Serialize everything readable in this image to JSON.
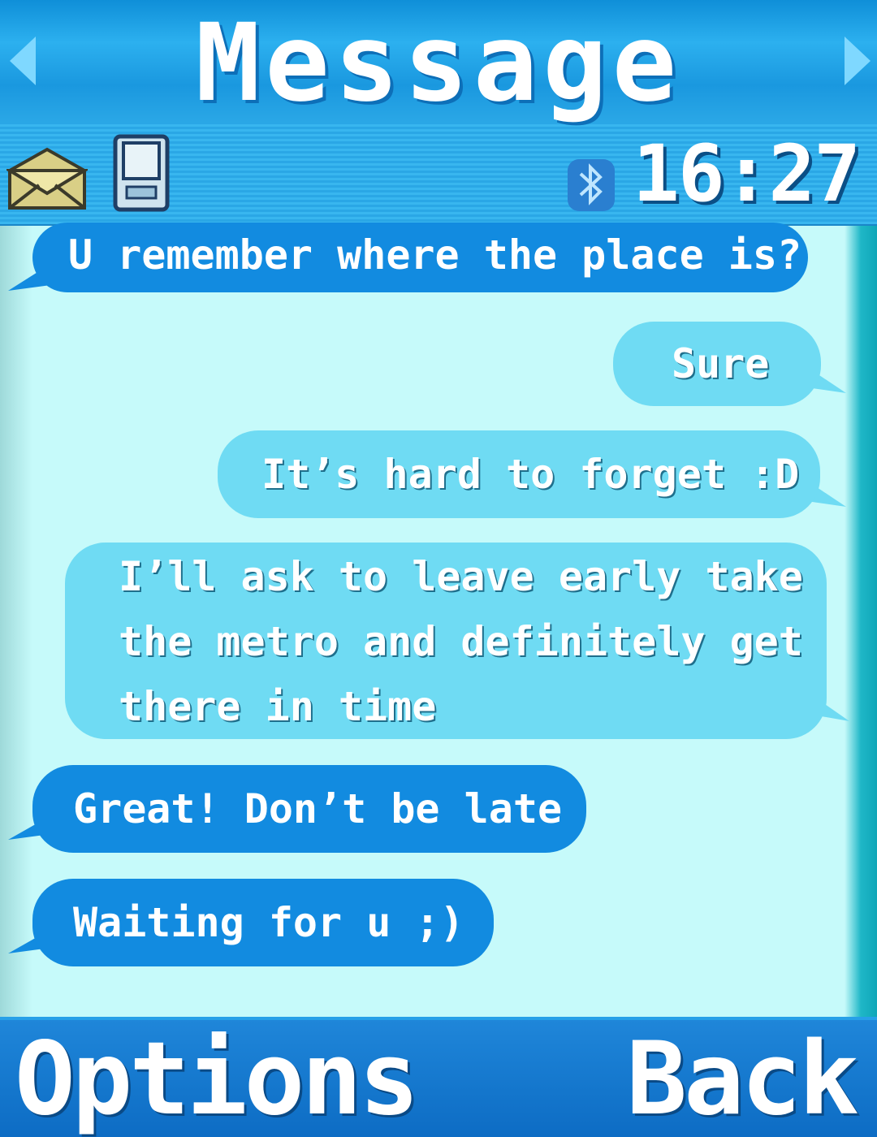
{
  "header": {
    "title": "Message",
    "clock": "16:27"
  },
  "icons": {
    "message": "envelope-icon",
    "phone": "phone-icon",
    "bluetooth": "bluetooth-icon"
  },
  "messages": [
    {
      "direction": "incoming",
      "text": "U remember where the place is?"
    },
    {
      "direction": "outgoing",
      "text": "Sure"
    },
    {
      "direction": "outgoing",
      "text": "It’s hard to forget :D"
    },
    {
      "direction": "outgoing",
      "lines": [
        "I’ll ask to leave early take",
        "the metro and definitely get",
        "there in time"
      ]
    },
    {
      "direction": "incoming",
      "text": "Great! Don’t be late"
    },
    {
      "direction": "incoming",
      "text": "Waiting for u ;)"
    }
  ],
  "softkeys": {
    "left": "Options",
    "right": "Back"
  },
  "colors": {
    "incoming_bubble": "#128be0",
    "outgoing_bubble": "#6fdbf3",
    "background": "#c6fafa",
    "header": "#2aa7e6"
  }
}
